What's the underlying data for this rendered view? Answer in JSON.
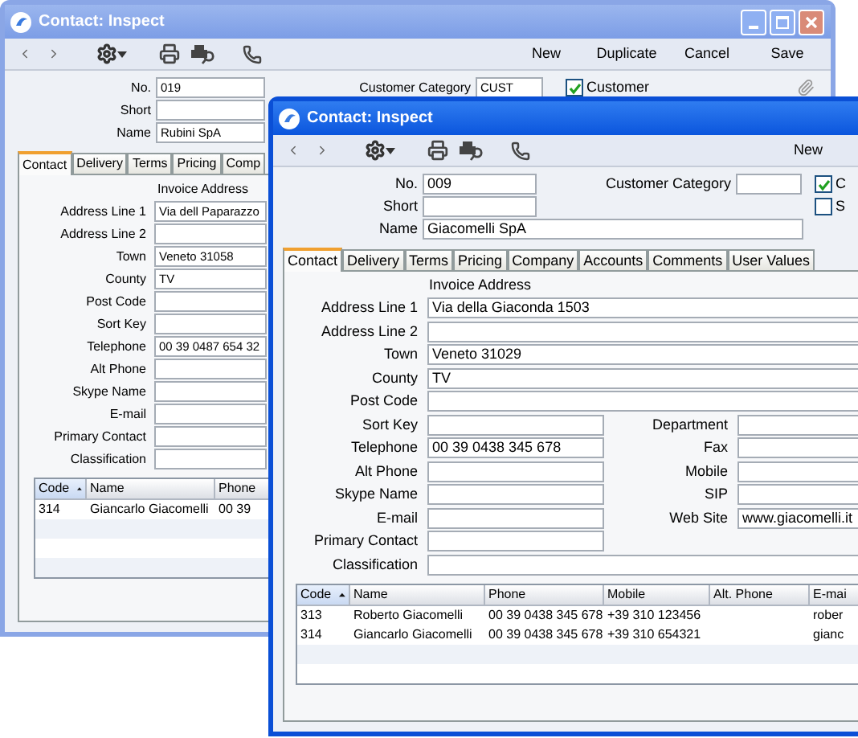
{
  "windows": [
    {
      "active": false,
      "title": "Contact: Inspect",
      "toolbar_buttons": [
        "New",
        "Duplicate",
        "Cancel",
        "Save"
      ],
      "header_fields": [
        {
          "label": "No.",
          "value": "019"
        },
        {
          "label": "Short"
        },
        {
          "label": "Name",
          "value": "Rubini SpA"
        }
      ],
      "customer_category": {
        "label": "Customer Category",
        "value": "CUST"
      },
      "checkboxes": [
        {
          "label": "Customer",
          "checked": true
        }
      ],
      "tabs": [
        {
          "label": "Contact",
          "selected": true
        },
        {
          "label": "Delivery",
          "selected": false
        },
        {
          "label": "Terms",
          "selected": false
        },
        {
          "label": "Pricing",
          "selected": false
        },
        {
          "label": "Comp",
          "selected": false
        }
      ],
      "section_title": "Invoice Address",
      "rows": [
        {
          "kind": "full",
          "field": {
            "label": "Address Line 1",
            "value": "Via dell Paparazzo"
          }
        },
        {
          "kind": "full",
          "field": {
            "label": "Address Line 2"
          }
        },
        {
          "kind": "full",
          "field": {
            "label": "Town",
            "value": "Veneto 31058"
          }
        },
        {
          "kind": "full",
          "field": {
            "label": "County",
            "value": "TV"
          }
        },
        {
          "kind": "full",
          "field": {
            "label": "Post Code"
          }
        },
        {
          "kind": "full",
          "field": {
            "label": "Sort Key"
          }
        },
        {
          "kind": "full",
          "field": {
            "label": "Telephone",
            "value": "00 39 0487 654 32"
          }
        },
        {
          "kind": "full",
          "field": {
            "label": "Alt Phone"
          }
        },
        {
          "kind": "full",
          "field": {
            "label": "Skype Name"
          }
        },
        {
          "kind": "full",
          "field": {
            "label": "E-mail"
          }
        },
        {
          "kind": "full",
          "field": {
            "label": "Primary Contact"
          }
        },
        {
          "kind": "full",
          "field": {
            "label": "Classification"
          }
        }
      ],
      "table": {
        "columns": [
          {
            "label": "Code",
            "sorted": true
          },
          {
            "label": "Name",
            "sorted": false
          },
          {
            "label": "Phone",
            "sorted": false
          }
        ],
        "rows": [
          [
            "314",
            "Giancarlo Giacomelli",
            "00 39"
          ]
        ]
      }
    },
    {
      "active": true,
      "title": "Contact: Inspect",
      "toolbar_buttons": [
        "New"
      ],
      "header_fields": [
        {
          "label": "No.",
          "value": "009"
        },
        {
          "label": "Short"
        },
        {
          "label": "Name",
          "value": "Giacomelli SpA"
        }
      ],
      "customer_category": {
        "label": "Customer Category"
      },
      "checkboxes": [
        {
          "label": "C",
          "checked": true
        },
        {
          "label": "S",
          "checked": false
        }
      ],
      "tabs": [
        {
          "label": "Contact",
          "selected": true
        },
        {
          "label": "Delivery",
          "selected": false
        },
        {
          "label": "Terms",
          "selected": false
        },
        {
          "label": "Pricing",
          "selected": false
        },
        {
          "label": "Company",
          "selected": false
        },
        {
          "label": "Accounts",
          "selected": false
        },
        {
          "label": "Comments",
          "selected": false
        },
        {
          "label": "User Values",
          "selected": false
        }
      ],
      "section_title": "Invoice Address",
      "rows": [
        {
          "kind": "full",
          "field": {
            "label": "Address Line 1",
            "value": "Via della Giaconda 1503"
          }
        },
        {
          "kind": "full",
          "field": {
            "label": "Address Line 2"
          }
        },
        {
          "kind": "full",
          "field": {
            "label": "Town",
            "value": "Veneto 31029"
          }
        },
        {
          "kind": "full",
          "field": {
            "label": "County",
            "value": "TV"
          }
        },
        {
          "kind": "full",
          "field": {
            "label": "Post Code"
          }
        },
        {
          "kind": "pair",
          "left": {
            "label": "Sort Key"
          },
          "right": {
            "label": "Department"
          }
        },
        {
          "kind": "pair",
          "left": {
            "label": "Telephone",
            "value": "00 39 0438 345 678"
          },
          "right": {
            "label": "Fax"
          }
        },
        {
          "kind": "pair",
          "left": {
            "label": "Alt Phone"
          },
          "right": {
            "label": "Mobile"
          }
        },
        {
          "kind": "pair",
          "left": {
            "label": "Skype Name"
          },
          "right": {
            "label": "SIP"
          }
        },
        {
          "kind": "pair",
          "left": {
            "label": "E-mail"
          },
          "right": {
            "label": "Web Site",
            "value": "www.giacomelli.it"
          }
        },
        {
          "kind": "pair",
          "left": {
            "label": "Primary Contact"
          }
        },
        {
          "kind": "full",
          "field": {
            "label": "Classification"
          }
        }
      ],
      "table": {
        "columns": [
          {
            "label": "Code",
            "sorted": true
          },
          {
            "label": "Name",
            "sorted": false
          },
          {
            "label": "Phone",
            "sorted": false
          },
          {
            "label": "Mobile",
            "sorted": false
          },
          {
            "label": "Alt. Phone",
            "sorted": false
          },
          {
            "label": "E-mai",
            "sorted": false
          }
        ],
        "rows": [
          [
            "313",
            "Roberto Giacomelli",
            "00 39 0438 345 678",
            "+39 310 123456",
            null,
            "rober"
          ],
          [
            "314",
            "Giancarlo Giacomelli",
            "00 39 0438 345 678",
            "+39 310 654321",
            null,
            "gianc"
          ]
        ]
      }
    }
  ]
}
